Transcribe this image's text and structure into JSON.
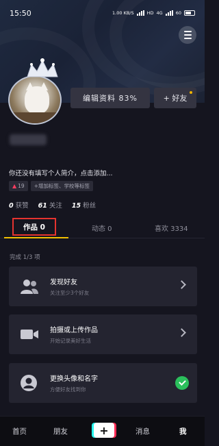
{
  "status_bar": {
    "time": "15:50",
    "net_speed": "1.00 KB/S",
    "hd": "HD",
    "network": "4G",
    "battery_level": "60"
  },
  "profile": {
    "edit_profile_label": "编辑资料 83%",
    "add_friend_label": "+ 好友",
    "bio": "你还没有填写个人简介，点击添加...",
    "tags": [
      "19",
      "+增加标签、学校等标签"
    ],
    "stats": [
      {
        "value": "0",
        "label": "获赞"
      },
      {
        "value": "61",
        "label": "关注"
      },
      {
        "value": "15",
        "label": "粉丝"
      }
    ]
  },
  "tabs": [
    {
      "label": "作品 0"
    },
    {
      "label": "动态 0"
    },
    {
      "label": "喜欢 3334"
    }
  ],
  "works_hint": "完成 1/3 项",
  "cards": [
    {
      "title": "发现好友",
      "subtitle": "关注至少3个好友",
      "icon": "people-icon",
      "status": "arrow"
    },
    {
      "title": "拍摄或上传作品",
      "subtitle": "开始记录美好生活",
      "icon": "video-camera-icon",
      "status": "arrow"
    },
    {
      "title": "更换头像和名字",
      "subtitle": "方便好友找到你",
      "icon": "avatar-icon",
      "status": "done"
    }
  ],
  "bottom_nav": {
    "home": "首页",
    "friends": "朋友",
    "create": "+",
    "messages": "消息",
    "me": "我"
  },
  "colors": {
    "accent_yellow": "#f2c000",
    "highlight_red": "#e5332f",
    "done_green": "#2bbf5c",
    "background": "#15151f"
  }
}
